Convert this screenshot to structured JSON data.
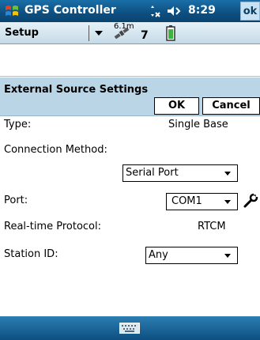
{
  "titlebar": {
    "app_title": "GPS Controller",
    "clock": "8:29",
    "ok_label": "ok",
    "icons": [
      "windows-logo-icon",
      "connectivity-icon",
      "volume-icon"
    ]
  },
  "toolbar": {
    "menu_label": "Setup",
    "satellite_height": "6.1m",
    "satellite_count": "7",
    "icons": [
      "satellite-icon",
      "battery-icon"
    ]
  },
  "form": {
    "title": "External Source Settings",
    "ok_button": "OK",
    "cancel_button": "Cancel",
    "type_label": "Type:",
    "type_value": "Single Base",
    "connection_label": "Connection Method:",
    "connection_value": "Serial Port",
    "port_label": "Port:",
    "port_value": "COM1",
    "protocol_label": "Real-time Protocol:",
    "protocol_value": "RTCM",
    "station_label": "Station ID:",
    "station_value": "Any"
  },
  "colors": {
    "titlebar": "#0d4f80",
    "header": "#b9d5e6",
    "toolbar": "#d4e6f0"
  }
}
